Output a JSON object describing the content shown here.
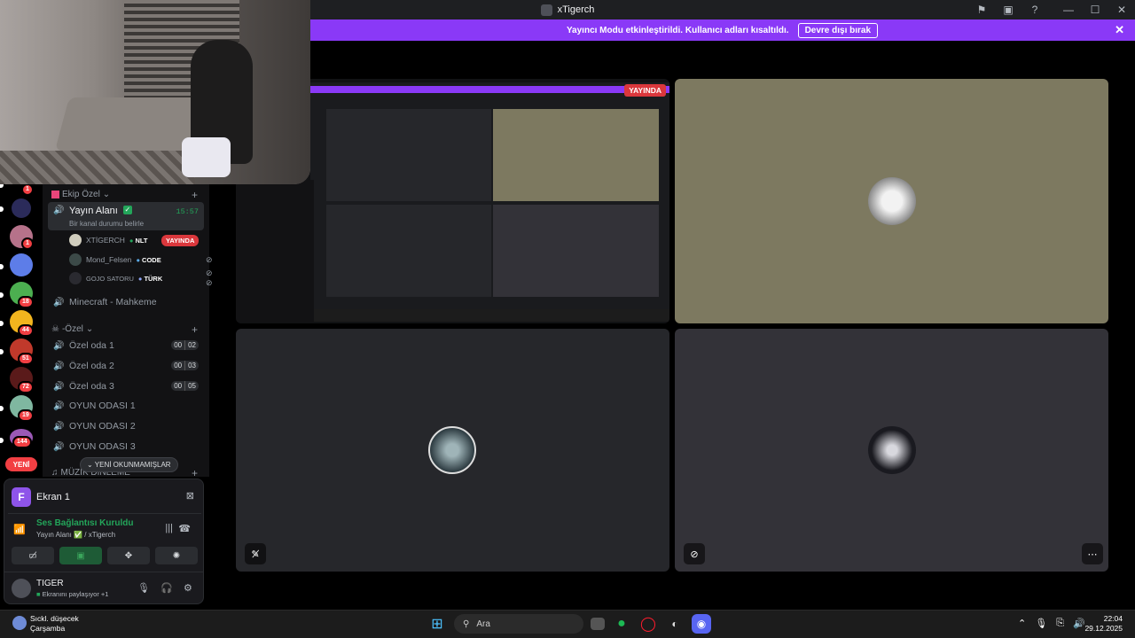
{
  "window": {
    "title": "xTigerch",
    "controls": [
      "⚑",
      "▣",
      "?",
      "—",
      "☐",
      "✕"
    ]
  },
  "banner": {
    "text": "Yayıncı Modu etkinleştirildi. Kullanıcı adları kısaltıldı.",
    "button": "Devre dışı bırak",
    "close": "✕"
  },
  "rail": {
    "badges": [
      "1",
      "1",
      "18",
      "44",
      "51",
      "72",
      "19",
      "144"
    ],
    "new_label": "YENİ"
  },
  "channels": {
    "category1": "Ekip Özel",
    "active_channel": {
      "name": "Yayın Alanı",
      "time": "15:57",
      "status": "Bir kanal durumu belirle"
    },
    "users": [
      {
        "name": "XTİGERCH",
        "badge": "NLT",
        "live": "YAYINDA"
      },
      {
        "name": "Mond_Felsen",
        "badge": "CODE"
      },
      {
        "name": "GOJO SATORU",
        "badge": "TÜRK"
      }
    ],
    "other_channel": "Minecraft - Mahkeme",
    "category2": "-Özel",
    "rooms": [
      {
        "name": "Özel oda 1",
        "a": "00",
        "b": "02"
      },
      {
        "name": "Özel oda 2",
        "a": "00",
        "b": "03"
      },
      {
        "name": "Özel oda 3",
        "a": "00",
        "b": "05"
      },
      {
        "name": "OYUN ODASI 1"
      },
      {
        "name": "OYUN ODASI 2"
      },
      {
        "name": "OYUN ODASI 3"
      }
    ],
    "category3": "MÜZİK DİNLEME",
    "unread_pill": "YENİ OKUNMAMIŞLAR"
  },
  "voice_panel": {
    "stream_initial": "F",
    "stream_name": "Ekran 1",
    "connection_title": "Ses Bağlantısı Kuruldu",
    "connection_sub": "Yayın Alanı ✅ / xTigerch",
    "user_name": "TIGER",
    "user_status": "Ekranını paylaşıyor +1"
  },
  "tiles": {
    "live_badge": "YAYINDA"
  },
  "taskbar": {
    "weather_title": "Sıckl. düşecek",
    "weather_sub": "Çarşamba",
    "search_placeholder": "Ara",
    "time": "22:04",
    "date": "29.12.2025"
  },
  "colors": {
    "accent": "#8a39f7",
    "live": "#da373c",
    "online": "#23a55a"
  }
}
